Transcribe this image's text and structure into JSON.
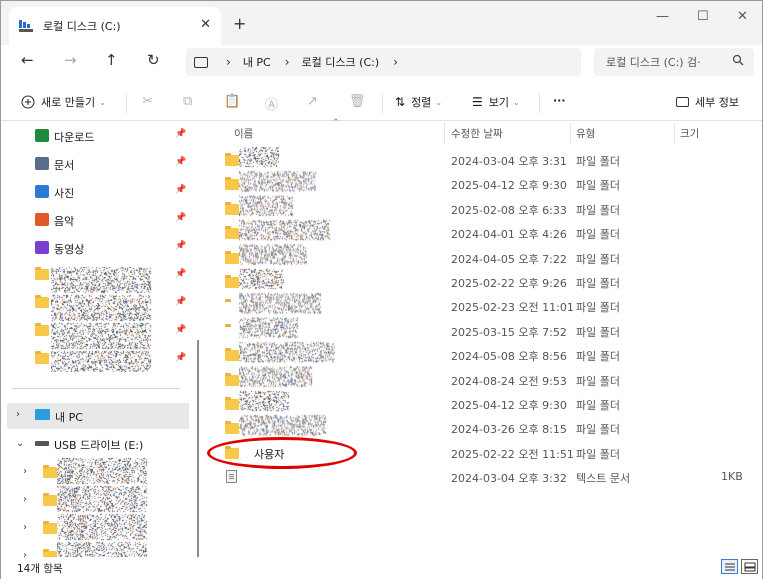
{
  "tab": {
    "title": "로컬 디스크 (C:)",
    "close": "✕",
    "new_tab": "+"
  },
  "window_controls": {
    "minimize": "—",
    "maximize": "☐",
    "close": "✕"
  },
  "nav": {
    "back": "←",
    "forward": "→",
    "up": "↑",
    "refresh": "↻"
  },
  "breadcrumb": [
    "내 PC",
    "로컬 디스크 (C:)"
  ],
  "breadcrumb_sep": "›",
  "search": {
    "placeholder": "로컬 디스크 (C:) 검·"
  },
  "toolbar": {
    "new_label": "새로 만들기",
    "sort_label": "정렬",
    "view_label": "보기",
    "more_label": "···",
    "details_label": "세부 정보"
  },
  "quick_access": [
    {
      "label": "다운로드",
      "icon": "download-icon",
      "color": "#1f8a3a"
    },
    {
      "label": "문서",
      "icon": "document-icon",
      "color": "#5b6b8c"
    },
    {
      "label": "사진",
      "icon": "pictures-icon",
      "color": "#2b7bd6"
    },
    {
      "label": "음악",
      "icon": "music-icon",
      "color": "#e2582a"
    },
    {
      "label": "동영상",
      "icon": "video-icon",
      "color": "#7a3fd1"
    }
  ],
  "tree": {
    "this_pc": "내 PC",
    "usb": "USB 드라이브 (E:)"
  },
  "columns": {
    "name": "이름",
    "date": "수정한 날짜",
    "type": "유형",
    "size": "크기"
  },
  "rows": [
    {
      "name": "",
      "date": "2024-03-04 오후 3:31",
      "type": "파일 폴더",
      "size": ""
    },
    {
      "name": "",
      "date": "2025-04-12 오후 9:30",
      "type": "파일 폴더",
      "size": ""
    },
    {
      "name": "",
      "date": "2025-02-08 오후 6:33",
      "type": "파일 폴더",
      "size": ""
    },
    {
      "name": "",
      "date": "2024-04-01 오후 4:26",
      "type": "파일 폴더",
      "size": ""
    },
    {
      "name": "",
      "date": "2024-04-05 오후 7:22",
      "type": "파일 폴더",
      "size": ""
    },
    {
      "name": "",
      "date": "2025-02-22 오후 9:26",
      "type": "파일 폴더",
      "size": ""
    },
    {
      "name": "",
      "date": "2025-02-23 오전 11:01",
      "type": "파일 폴더",
      "size": ""
    },
    {
      "name": "",
      "date": "2025-03-15 오후 7:52",
      "type": "파일 폴더",
      "size": ""
    },
    {
      "name": "",
      "date": "2024-05-08 오후 8:56",
      "type": "파일 폴더",
      "size": ""
    },
    {
      "name": "",
      "date": "2024-08-24 오전 9:53",
      "type": "파일 폴더",
      "size": ""
    },
    {
      "name": "",
      "date": "2025-04-12 오후 9:30",
      "type": "파일 폴더",
      "size": ""
    },
    {
      "name": "",
      "date": "2024-03-26 오후 8:15",
      "type": "파일 폴더",
      "size": ""
    },
    {
      "name": "사용자",
      "date": "2025-02-22 오전 11:51",
      "type": "파일 폴더",
      "size": ""
    },
    {
      "name": "",
      "date": "2024-03-04 오후 3:32",
      "type": "텍스트 문서",
      "size": "1KB"
    }
  ],
  "status": {
    "item_count": "14개 항목"
  },
  "colors": {
    "folder": "#f7c84a",
    "highlight": "#e00000",
    "selection": "#e8e8e8"
  }
}
